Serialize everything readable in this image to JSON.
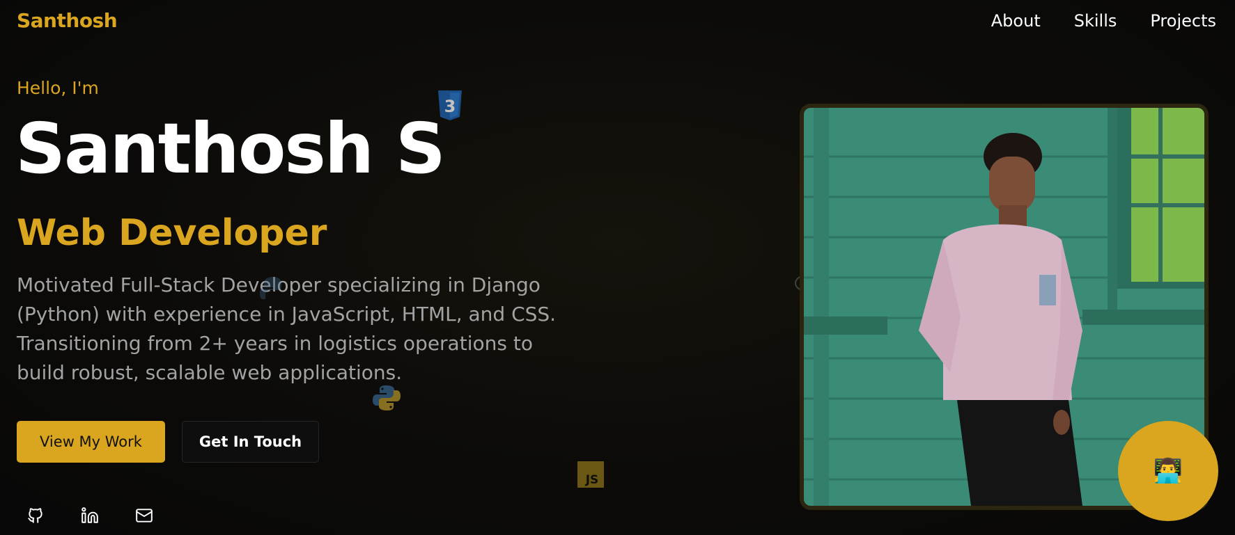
{
  "nav": {
    "brand": "Santhosh",
    "links": [
      "About",
      "Skills",
      "Projects"
    ]
  },
  "hero": {
    "greeting": "Hello, I'm",
    "name": "Santhosh S",
    "role": "Web Developer",
    "description": "Motivated Full-Stack Developer specializing in Django (Python) with experience in JavaScript, HTML, and CSS. Transitioning from 2+ years in logistics operations to build robust, scalable web applications.",
    "primary_button": "View My Work",
    "secondary_button": "Get In Touch"
  },
  "floating_icons": {
    "css_label": "3",
    "js_label": "JS"
  },
  "social": [
    "github-icon",
    "linkedin-icon",
    "mail-icon"
  ],
  "chat": {
    "icon": "👨‍💻"
  },
  "colors": {
    "accent": "#dba61f",
    "background": "#0a0a0a",
    "muted_text": "#a3a3a3"
  }
}
